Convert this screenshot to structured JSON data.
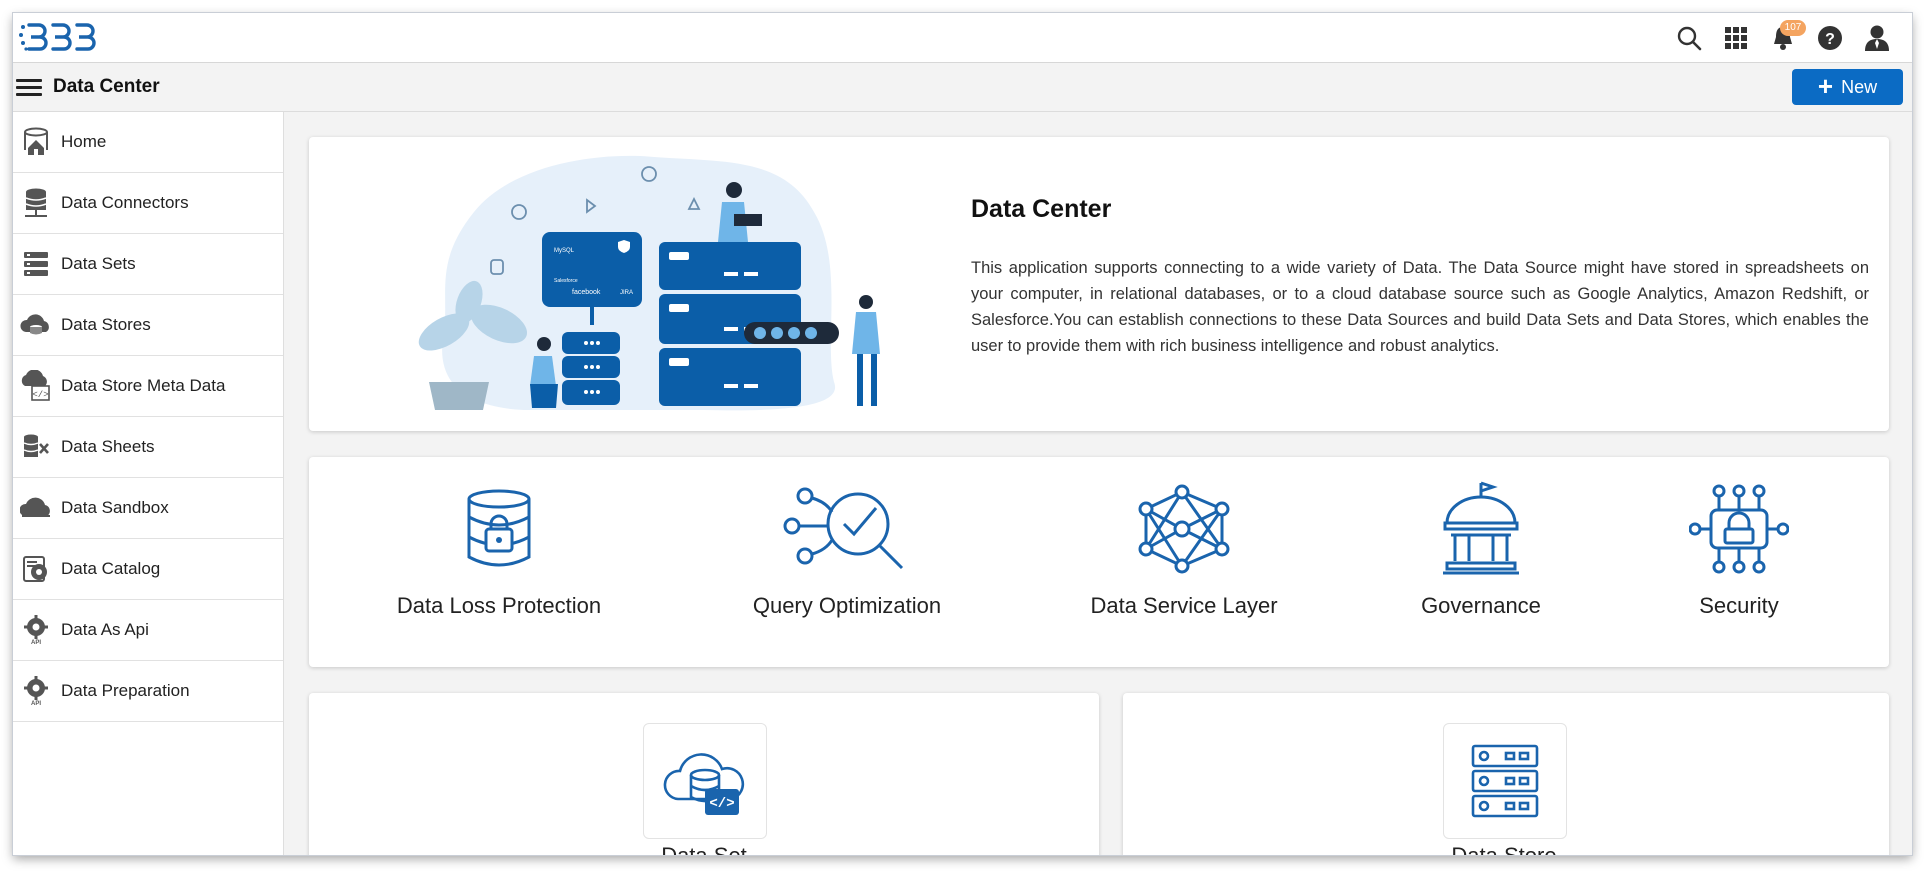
{
  "header": {
    "logo_text": "BDB",
    "notification_count": "107"
  },
  "subbar": {
    "title": "Data Center",
    "new_label": "New"
  },
  "sidebar": {
    "items": [
      {
        "label": "Home",
        "icon": "home-icon"
      },
      {
        "label": "Data Connectors",
        "icon": "database-connector-icon"
      },
      {
        "label": "Data Sets",
        "icon": "data-sets-icon"
      },
      {
        "label": "Data Stores",
        "icon": "cloud-database-icon"
      },
      {
        "label": "Data Store Meta Data",
        "icon": "code-database-icon"
      },
      {
        "label": "Data Sheets",
        "icon": "spreadsheet-icon"
      },
      {
        "label": "Data Sandbox",
        "icon": "sandbox-cloud-icon"
      },
      {
        "label": "Data Catalog",
        "icon": "catalog-gear-icon"
      },
      {
        "label": "Data As Api",
        "icon": "api-gear-icon"
      },
      {
        "label": "Data Preparation",
        "icon": "preparation-gear-icon"
      }
    ]
  },
  "hero": {
    "title": "Data Center",
    "description": "This application supports connecting to a wide variety of Data. The Data Source might have stored in spreadsheets on your computer, in relational databases, or to a cloud database source such as Google Analytics, Amazon Redshift, or Salesforce.You can establish connections to these Data Sources and build Data Sets and Data Stores, which enables the user to provide them with rich business intelligence and robust analytics.",
    "illustration_labels": [
      "facebook",
      "JIRA",
      "MySQL",
      "Salesforce"
    ]
  },
  "features": [
    {
      "label": "Data Loss Protection",
      "icon": "database-lock-icon"
    },
    {
      "label": "Query Optimization",
      "icon": "magnifier-check-icon"
    },
    {
      "label": "Data Service Layer",
      "icon": "network-nodes-icon"
    },
    {
      "label": "Governance",
      "icon": "capitol-building-icon"
    },
    {
      "label": "Security",
      "icon": "circuit-lock-icon"
    }
  ],
  "bottom_cards": [
    {
      "label": "Data Set",
      "icon": "cloud-code-database-icon"
    },
    {
      "label": "Data Store",
      "icon": "server-rack-icon"
    }
  ],
  "colors": {
    "brand": "#0b6bc4",
    "icon_blue": "#1a64ad",
    "badge": "#f4a460"
  }
}
